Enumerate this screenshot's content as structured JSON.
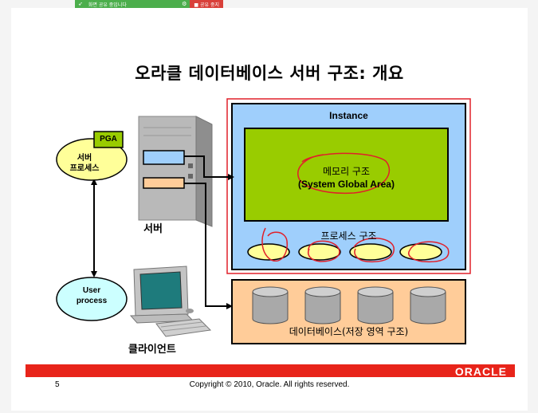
{
  "share_toolbar": {
    "label": "화면 공유 중입니다",
    "stop_label": "■ 공유 중지"
  },
  "slide": {
    "title": "오라클 데이터베이스 서버 구조: 개요",
    "instance_label": "Instance",
    "sga_label_line1": "메모리 구조",
    "sga_label_line2": "(System Global Area)",
    "process_structure_label": "프로세스 구조",
    "pga_label": "PGA",
    "server_process_line1": "서버",
    "server_process_line2": "프로세스",
    "user_process_line1": "User",
    "user_process_line2": "process",
    "server_label": "서버",
    "client_label": "클라이언트",
    "database_label": "데이터베이스(저장 영역 구조)",
    "logo": "ORACLE",
    "page_number": "5",
    "copyright": "Copyright © 2010, Oracle. All rights reserved."
  },
  "colors": {
    "instance_bg": "#9fcffc",
    "sga_bg": "#99cc00",
    "ellipse_fill": "#ffff99",
    "db_bg": "#ffcc99",
    "user_process_fill": "#ccffff",
    "server_process_fill": "#ffff99",
    "pga_fill": "#99cc00",
    "annotation_red": "#e0202a",
    "brand_red": "#e8241a"
  }
}
